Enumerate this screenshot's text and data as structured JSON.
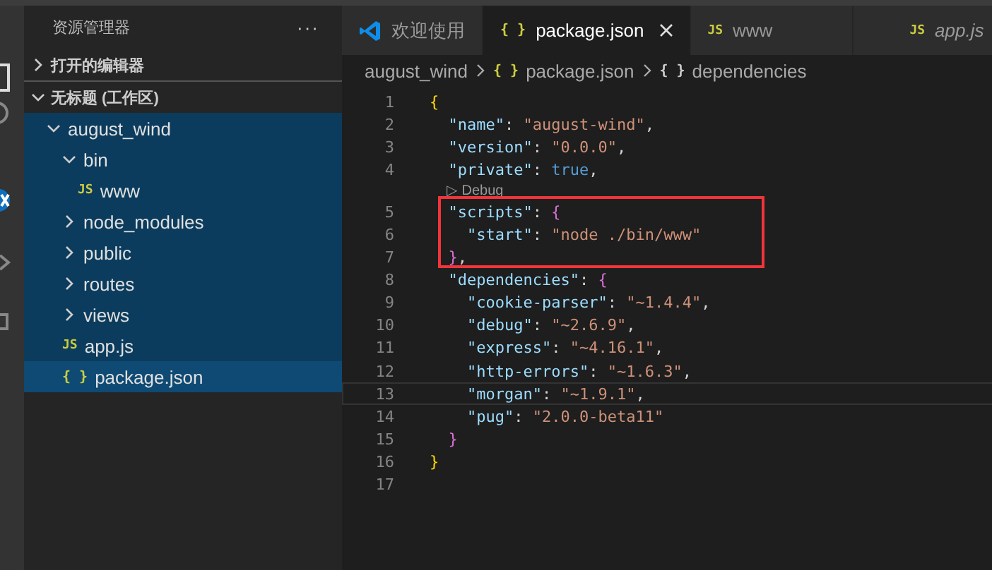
{
  "sidebar": {
    "title": "资源管理器",
    "more": "···",
    "sections": [
      {
        "label": "打开的编辑器",
        "expanded": false
      },
      {
        "label": "无标题 (工作区)",
        "expanded": true,
        "children": [
          {
            "label": "august_wind",
            "kind": "folder",
            "expanded": true,
            "selected": false,
            "children": [
              {
                "label": "bin",
                "kind": "folder",
                "expanded": true,
                "selected": false,
                "children": [
                  {
                    "label": "www",
                    "kind": "js",
                    "icon": "JS",
                    "selected": false
                  }
                ]
              },
              {
                "label": "node_modules",
                "kind": "folder",
                "expanded": false,
                "selected": false
              },
              {
                "label": "public",
                "kind": "folder",
                "expanded": false,
                "selected": false
              },
              {
                "label": "routes",
                "kind": "folder",
                "expanded": false,
                "selected": false
              },
              {
                "label": "views",
                "kind": "folder",
                "expanded": false,
                "selected": false
              },
              {
                "label": "app.js",
                "kind": "js",
                "icon": "JS",
                "selected": false
              },
              {
                "label": "package.json",
                "kind": "json",
                "icon": "{ }",
                "selected": true
              }
            ]
          }
        ]
      }
    ]
  },
  "tabs": [
    {
      "label": "欢迎使用",
      "kind": "welcome",
      "selected": false,
      "preview": false
    },
    {
      "label": "package.json",
      "kind": "json",
      "icon": "{ }",
      "selected": true,
      "preview": false
    },
    {
      "label": "www",
      "kind": "js",
      "icon": "JS",
      "selected": false,
      "preview": false
    },
    {
      "label": "app.js",
      "kind": "js",
      "icon": "JS",
      "selected": false,
      "preview": true
    }
  ],
  "breadcrumbs": [
    {
      "label": "august_wind",
      "kind": "folder"
    },
    {
      "label": "package.json",
      "kind": "json",
      "icon": "{ }"
    },
    {
      "label": "dependencies",
      "kind": "object",
      "icon": "{ }"
    }
  ],
  "code": [
    {
      "number": "1",
      "tokens": [
        {
          "kind": "brace",
          "text": "{"
        }
      ]
    },
    {
      "number": "2",
      "tokens": [
        {
          "kind": "key",
          "text": "  \"name\""
        },
        {
          "kind": "punct",
          "text": ": "
        },
        {
          "kind": "string",
          "text": "\"august-wind\""
        },
        {
          "kind": "punct",
          "text": ","
        }
      ]
    },
    {
      "number": "3",
      "tokens": [
        {
          "kind": "key",
          "text": "  \"version\""
        },
        {
          "kind": "punct",
          "text": ": "
        },
        {
          "kind": "string",
          "text": "\"0.0.0\""
        },
        {
          "kind": "punct",
          "text": ","
        }
      ]
    },
    {
      "number": "4",
      "tokens": [
        {
          "kind": "key",
          "text": "  \"private\""
        },
        {
          "kind": "punct",
          "text": ": "
        },
        {
          "kind": "bool",
          "text": "true"
        },
        {
          "kind": "punct",
          "text": ","
        }
      ]
    },
    {
      "codelens": "▷ Debug"
    },
    {
      "number": "5",
      "tokens": [
        {
          "kind": "key",
          "text": "  \"scripts\""
        },
        {
          "kind": "punct",
          "text": ": "
        },
        {
          "kind": "brace2",
          "text": "{"
        }
      ]
    },
    {
      "number": "6",
      "tokens": [
        {
          "kind": "key",
          "text": "    \"start\""
        },
        {
          "kind": "punct",
          "text": ": "
        },
        {
          "kind": "string",
          "text": "\"node ./bin/www\""
        }
      ]
    },
    {
      "number": "7",
      "tokens": [
        {
          "kind": "brace2",
          "text": "  }"
        },
        {
          "kind": "punct",
          "text": ","
        }
      ]
    },
    {
      "number": "8",
      "tokens": [
        {
          "kind": "key",
          "text": "  \"dependencies\""
        },
        {
          "kind": "punct",
          "text": ": "
        },
        {
          "kind": "brace2",
          "text": "{"
        }
      ]
    },
    {
      "number": "9",
      "tokens": [
        {
          "kind": "key",
          "text": "    \"cookie-parser\""
        },
        {
          "kind": "punct",
          "text": ": "
        },
        {
          "kind": "string",
          "text": "\"~1.4.4\""
        },
        {
          "kind": "punct",
          "text": ","
        }
      ]
    },
    {
      "number": "10",
      "tokens": [
        {
          "kind": "key",
          "text": "    \"debug\""
        },
        {
          "kind": "punct",
          "text": ": "
        },
        {
          "kind": "string",
          "text": "\"~2.6.9\""
        },
        {
          "kind": "punct",
          "text": ","
        }
      ]
    },
    {
      "number": "11",
      "tokens": [
        {
          "kind": "key",
          "text": "    \"express\""
        },
        {
          "kind": "punct",
          "text": ": "
        },
        {
          "kind": "string",
          "text": "\"~4.16.1\""
        },
        {
          "kind": "punct",
          "text": ","
        }
      ]
    },
    {
      "number": "12",
      "tokens": [
        {
          "kind": "key",
          "text": "    \"http-errors\""
        },
        {
          "kind": "punct",
          "text": ": "
        },
        {
          "kind": "string",
          "text": "\"~1.6.3\""
        },
        {
          "kind": "punct",
          "text": ","
        }
      ]
    },
    {
      "number": "13",
      "current": true,
      "tokens": [
        {
          "kind": "key",
          "text": "    \"morgan\""
        },
        {
          "kind": "punct",
          "text": ": "
        },
        {
          "kind": "string",
          "text": "\"~1.9.1\""
        },
        {
          "kind": "punct",
          "text": ","
        }
      ]
    },
    {
      "number": "14",
      "tokens": [
        {
          "kind": "key",
          "text": "    \"pug\""
        },
        {
          "kind": "punct",
          "text": ": "
        },
        {
          "kind": "string",
          "text": "\"2.0.0-beta11\""
        }
      ]
    },
    {
      "number": "15",
      "tokens": [
        {
          "kind": "brace2",
          "text": "  }"
        }
      ]
    },
    {
      "number": "16",
      "tokens": [
        {
          "kind": "brace",
          "text": "}"
        }
      ]
    },
    {
      "number": "17"
    }
  ]
}
